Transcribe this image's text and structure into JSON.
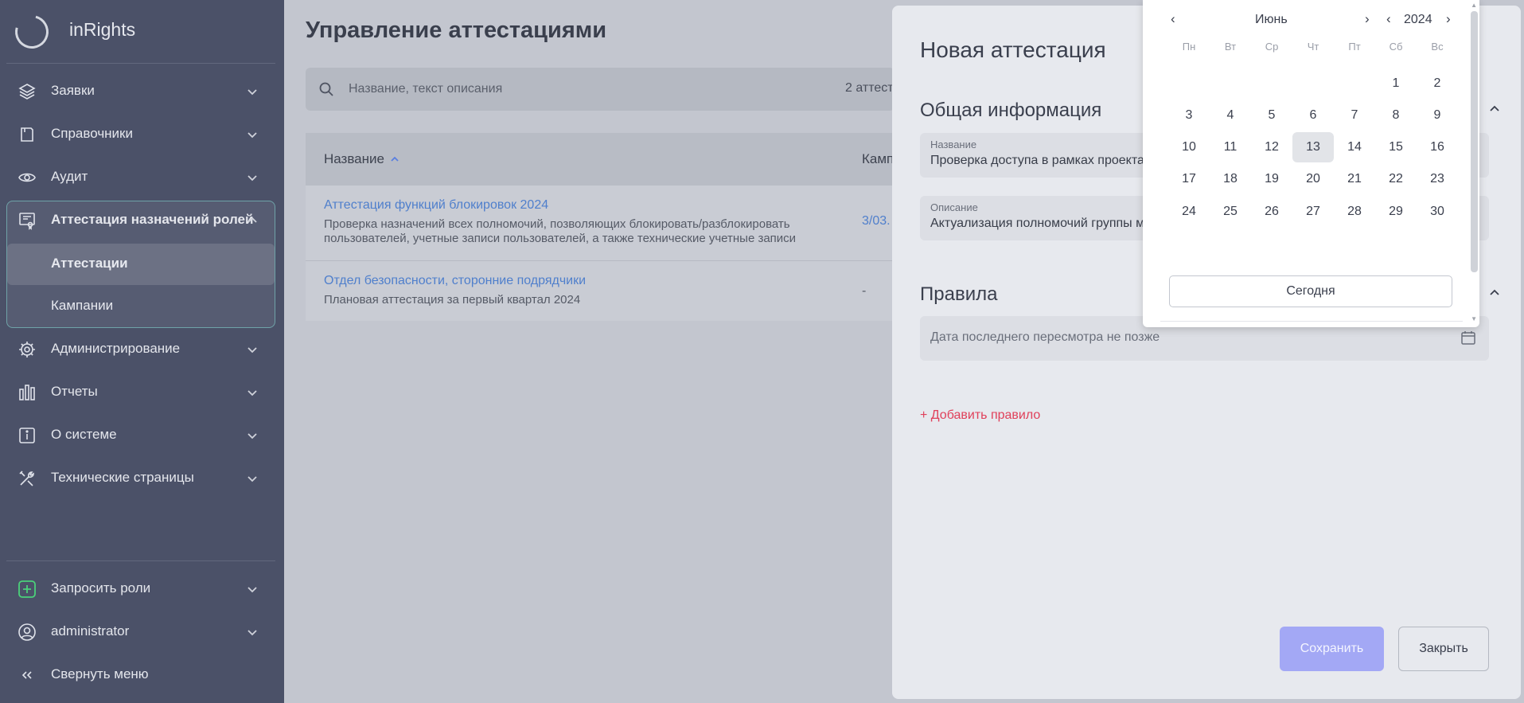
{
  "app": {
    "name": "inRights"
  },
  "sidebar": {
    "items": [
      {
        "label": "Заявки",
        "icon": "layers-icon"
      },
      {
        "label": "Справочники",
        "icon": "book-icon"
      },
      {
        "label": "Аудит",
        "icon": "eye-icon"
      },
      {
        "label": "Аттестация назначений ролей",
        "icon": "certificate-icon",
        "expanded": true
      },
      {
        "label": "Администрирование",
        "icon": "gear-icon"
      },
      {
        "label": "Отчеты",
        "icon": "bar-chart-icon"
      },
      {
        "label": "О системе",
        "icon": "info-icon"
      },
      {
        "label": "Технические страницы",
        "icon": "tools-icon"
      }
    ],
    "subitems": [
      {
        "label": "Аттестации",
        "active": true
      },
      {
        "label": "Кампании",
        "active": false
      }
    ],
    "bottom": {
      "request_roles": "Запросить роли",
      "user": "administrator",
      "collapse": "Свернуть меню"
    }
  },
  "main": {
    "title": "Управление аттестациями",
    "search_placeholder": "Название, текст описания",
    "count_text": "2 аттест",
    "columns": {
      "name": "Название",
      "campaign": "Камп"
    },
    "rows": [
      {
        "title": "Аттестация функций блокировок 2024",
        "desc1": "Проверка назначений всех полномочий, позволяющих блокировать/разблокировать",
        "desc2": "пользователей, учетные записи пользователей, а также технические учетные записи",
        "campaign": "3/03."
      },
      {
        "title": "Отдел безопасности, сторонние подрядчики",
        "desc1": "Плановая аттестация за первый квартал 2024",
        "desc2": "",
        "campaign": "-"
      }
    ]
  },
  "panel": {
    "title": "Новая аттестация",
    "section_general": "Общая информация",
    "name_label": "Название",
    "name_value": "Проверка доступа в рамках проекта",
    "desc_label": "Описание",
    "desc_value": "Актуализация полномочий группы м",
    "section_rules": "Правила",
    "date_placeholder": "Дата последнего пересмотра не позже",
    "add_rule": "+ Добавить правило",
    "save": "Сохранить",
    "close": "Закрыть"
  },
  "datepicker": {
    "prev_month": "‹",
    "next_month": "›",
    "prev_year": "‹",
    "next_year": "›",
    "month": "Июнь",
    "year": "2024",
    "weekdays": [
      "Пн",
      "Вт",
      "Ср",
      "Чт",
      "Пт",
      "Сб",
      "Вс"
    ],
    "selected_day": "13",
    "weeks": [
      [
        "",
        "",
        "",
        "",
        "",
        "1",
        "2"
      ],
      [
        "3",
        "4",
        "5",
        "6",
        "7",
        "8",
        "9"
      ],
      [
        "10",
        "11",
        "12",
        "13",
        "14",
        "15",
        "16"
      ],
      [
        "17",
        "18",
        "19",
        "20",
        "21",
        "22",
        "23"
      ],
      [
        "24",
        "25",
        "26",
        "27",
        "28",
        "29",
        "30"
      ]
    ],
    "today": "Сегодня"
  }
}
